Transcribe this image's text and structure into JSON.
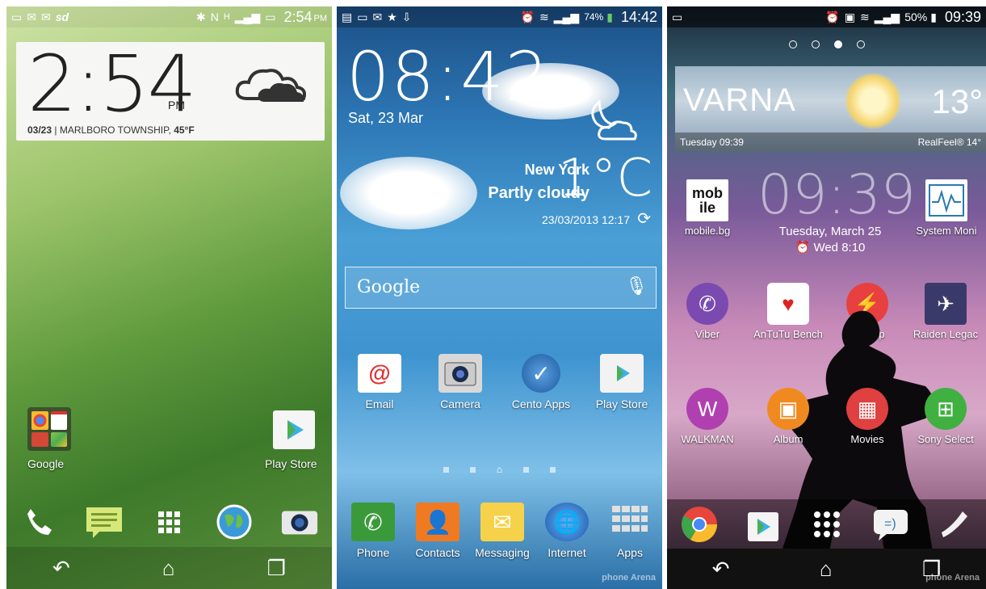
{
  "phone1": {
    "status": {
      "carrier_badge": "sd",
      "signal": "H",
      "time": "2:54",
      "ampm": "PM"
    },
    "clock": {
      "time": "2:54",
      "ampm": "PM",
      "date": "03/23",
      "location": "MARLBORO TOWNSHIP,",
      "temp": "45°F"
    },
    "apps": {
      "folder_label": "Google",
      "play_label": "Play Store"
    },
    "dock": [
      "phone-icon",
      "messages-icon",
      "apps-grid-icon",
      "internet-icon",
      "camera-icon"
    ],
    "nav": [
      "back-icon",
      "home-icon",
      "recents-icon"
    ]
  },
  "phone2": {
    "status": {
      "battery": "74%",
      "time": "14:42"
    },
    "clock": {
      "time": "08:42",
      "date": "Sat, 23 Mar"
    },
    "weather": {
      "city": "New York",
      "condition": "Partly cloudy",
      "temp": "1°C",
      "updated": "23/03/2013 12:17"
    },
    "search": {
      "placeholder": "Google"
    },
    "apps": [
      {
        "label": "Email",
        "icon": "email-icon",
        "color": "#ffffff"
      },
      {
        "label": "Camera",
        "icon": "camera-icon",
        "color": "#d8d8d8"
      },
      {
        "label": "Cento Apps",
        "icon": "cento-apps-icon",
        "color": "#1e5aa0"
      },
      {
        "label": "Play Store",
        "icon": "play-store-icon",
        "color": "#f2f2f2"
      }
    ],
    "dock": [
      {
        "label": "Phone",
        "icon": "phone-icon",
        "color": "#3a9a3a"
      },
      {
        "label": "Contacts",
        "icon": "contacts-icon",
        "color": "#f07a22"
      },
      {
        "label": "Messaging",
        "icon": "messaging-icon",
        "color": "#f6d24a"
      },
      {
        "label": "Internet",
        "icon": "internet-icon",
        "color": "#2a7ad0"
      },
      {
        "label": "Apps",
        "icon": "apps-icon",
        "color": "#cfcfcf"
      }
    ],
    "watermark": "phone Arena"
  },
  "phone3": {
    "status": {
      "battery": "50%",
      "time": "09:39"
    },
    "weather": {
      "city": "VARNA",
      "temp": "13°",
      "time": "Tuesday 09:39",
      "realfeel": "RealFeel® 14°"
    },
    "clock": {
      "time": "09:39",
      "date": "Tuesday, March 25",
      "alarm": "Wed 8:10"
    },
    "row1": [
      {
        "label": "mobile.bg",
        "icon": "mobile-bg-icon",
        "color": "#ffffff"
      },
      {
        "label": "System Moni",
        "icon": "system-monitor-icon",
        "color": "#ffffff"
      }
    ],
    "row2": [
      {
        "label": "Viber",
        "icon": "viber-icon",
        "color": "#7a4ab0"
      },
      {
        "label": "AnTuTu Bench",
        "icon": "antutu-icon",
        "color": "#ffffff"
      },
      {
        "label": "QuizUp",
        "icon": "quizup-icon",
        "color": "#e84040"
      },
      {
        "label": "Raiden Legac",
        "icon": "raiden-icon",
        "color": "#3a3a6a"
      }
    ],
    "row3": [
      {
        "label": "WALKMAN",
        "icon": "walkman-icon",
        "color": "#b040b0"
      },
      {
        "label": "Album",
        "icon": "album-icon",
        "color": "#f08a20"
      },
      {
        "label": "Movies",
        "icon": "movies-icon",
        "color": "#e04040"
      },
      {
        "label": "Sony Select",
        "icon": "sony-select-icon",
        "color": "#40b040"
      }
    ],
    "dock": [
      "chrome-icon",
      "play-store-icon",
      "apps-grid-icon",
      "messaging-icon",
      "phone-icon"
    ],
    "watermark": "phone Arena"
  }
}
